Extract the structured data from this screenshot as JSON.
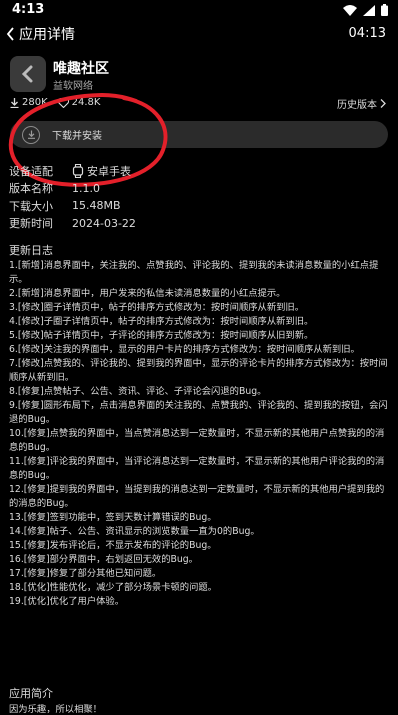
{
  "status_bar": {
    "time": "4:13"
  },
  "header": {
    "back_label": "应用详情",
    "time": "04:13"
  },
  "app": {
    "name": "唯趣社区",
    "developer": "益软网络"
  },
  "stats": {
    "downloads": "280K",
    "likes": "24.8K"
  },
  "history_label": "历史版本",
  "download_button": "下载并安装",
  "info": [
    {
      "key": "设备适配",
      "value": "安卓手表"
    },
    {
      "key": "版本名称",
      "value": "1.1.0"
    },
    {
      "key": "下载大小",
      "value": "15.48MB"
    },
    {
      "key": "更新时间",
      "value": "2024-03-22"
    }
  ],
  "changelog_title": "更新日志",
  "changelog": [
    "1.[新增]消息界面中，关注我的、点赞我的、评论我的、提到我的未读消息数量的小红点提示。",
    "2.[新增]消息界面中，用户发来的私信未读消息数量的小红点提示。",
    "3.[修改]圈子详情页中，帖子的排序方式修改为：按时间顺序从新到旧。",
    "4.[修改]子圈子详情页中，帖子的排序方式修改为：按时间顺序从新到旧。",
    "5.[修改]帖子详情页中，子评论的排序方式修改为：按时间顺序从旧到新。",
    "6.[修改]关注我的界面中，显示的用户卡片的排序方式修改为：按时间顺序从新到旧。",
    "7.[修改]点赞我的、评论我的、提到我的界面中，显示的评论卡片的排序方式修改为：按时间顺序从新到旧。",
    "8.[修复]点赞帖子、公告、资讯、评论、子评论会闪退的Bug。",
    "9.[修复]圆形布局下，点击消息界面的关注我的、点赞我的、评论我的、提到我的按钮，会闪退的Bug。",
    "10.[修复]点赞我的界面中，当点赞消息达到一定数量时，不显示新的其他用户点赞我的的消息的Bug。",
    "11.[修复]评论我的界面中，当评论消息达到一定数量时，不显示新的其他用户评论我的的消息的Bug。",
    "12.[修复]提到我的界面中，当提到我的消息达到一定数量时，不显示新的其他用户提到我的的消息的Bug。",
    "13.[修复]签到功能中，签到天数计算错误的Bug。",
    "14.[修复]帖子、公告、资讯显示的浏览数量一直为0的Bug。",
    "15.[修复]发布评论后，不显示发布的评论的Bug。",
    "16.[修复]部分界面中，右划返回无效的Bug。",
    "17.[修复]修复了部分其他已知问题。",
    "18.[优化]性能优化，减少了部分场景卡顿的问题。",
    "19.[优化]优化了用户体验。"
  ],
  "intro_title": "应用简介",
  "intro_text": "因为乐趣，所以相聚！",
  "colors": {
    "background": "#000000",
    "button_bg": "#2b2b2b",
    "annotation": "#e3202a"
  }
}
